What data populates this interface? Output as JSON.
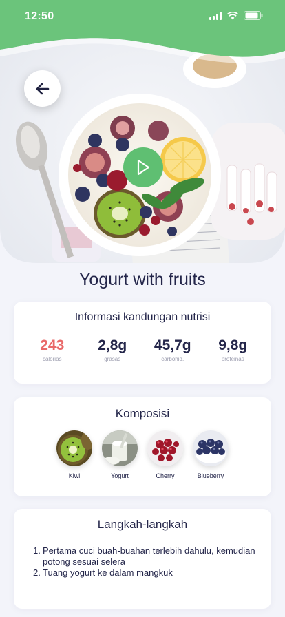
{
  "status": {
    "time": "12:50"
  },
  "recipe": {
    "title": "Yogurt with fruits"
  },
  "nutrition": {
    "title": "Informasi kandungan nutrisi",
    "items": [
      {
        "value": "243",
        "label": "calorias"
      },
      {
        "value": "2,8g",
        "label": "grasas"
      },
      {
        "value": "45,7g",
        "label": "carbohid."
      },
      {
        "value": "9,8g",
        "label": "proteinas"
      }
    ]
  },
  "composition": {
    "title": "Komposisi",
    "items": [
      {
        "label": "Kiwi"
      },
      {
        "label": "Yogurt"
      },
      {
        "label": "Cherry"
      },
      {
        "label": "Blueberry"
      }
    ]
  },
  "steps": {
    "title": "Langkah-langkah",
    "items": [
      {
        "num": "1.",
        "text": "Pertama cuci buah-buahan terlebih dahulu, kemudian potong sesuai selera"
      },
      {
        "num": "2.",
        "text": "Tuang yogurt ke dalam mangkuk"
      }
    ]
  },
  "colors": {
    "accent": "#5fbf72",
    "calorie": "#e96a6a",
    "text": "#24264a",
    "background": "#f3f4fa"
  },
  "icons": {
    "back": "arrow-left-icon",
    "play": "play-icon"
  }
}
